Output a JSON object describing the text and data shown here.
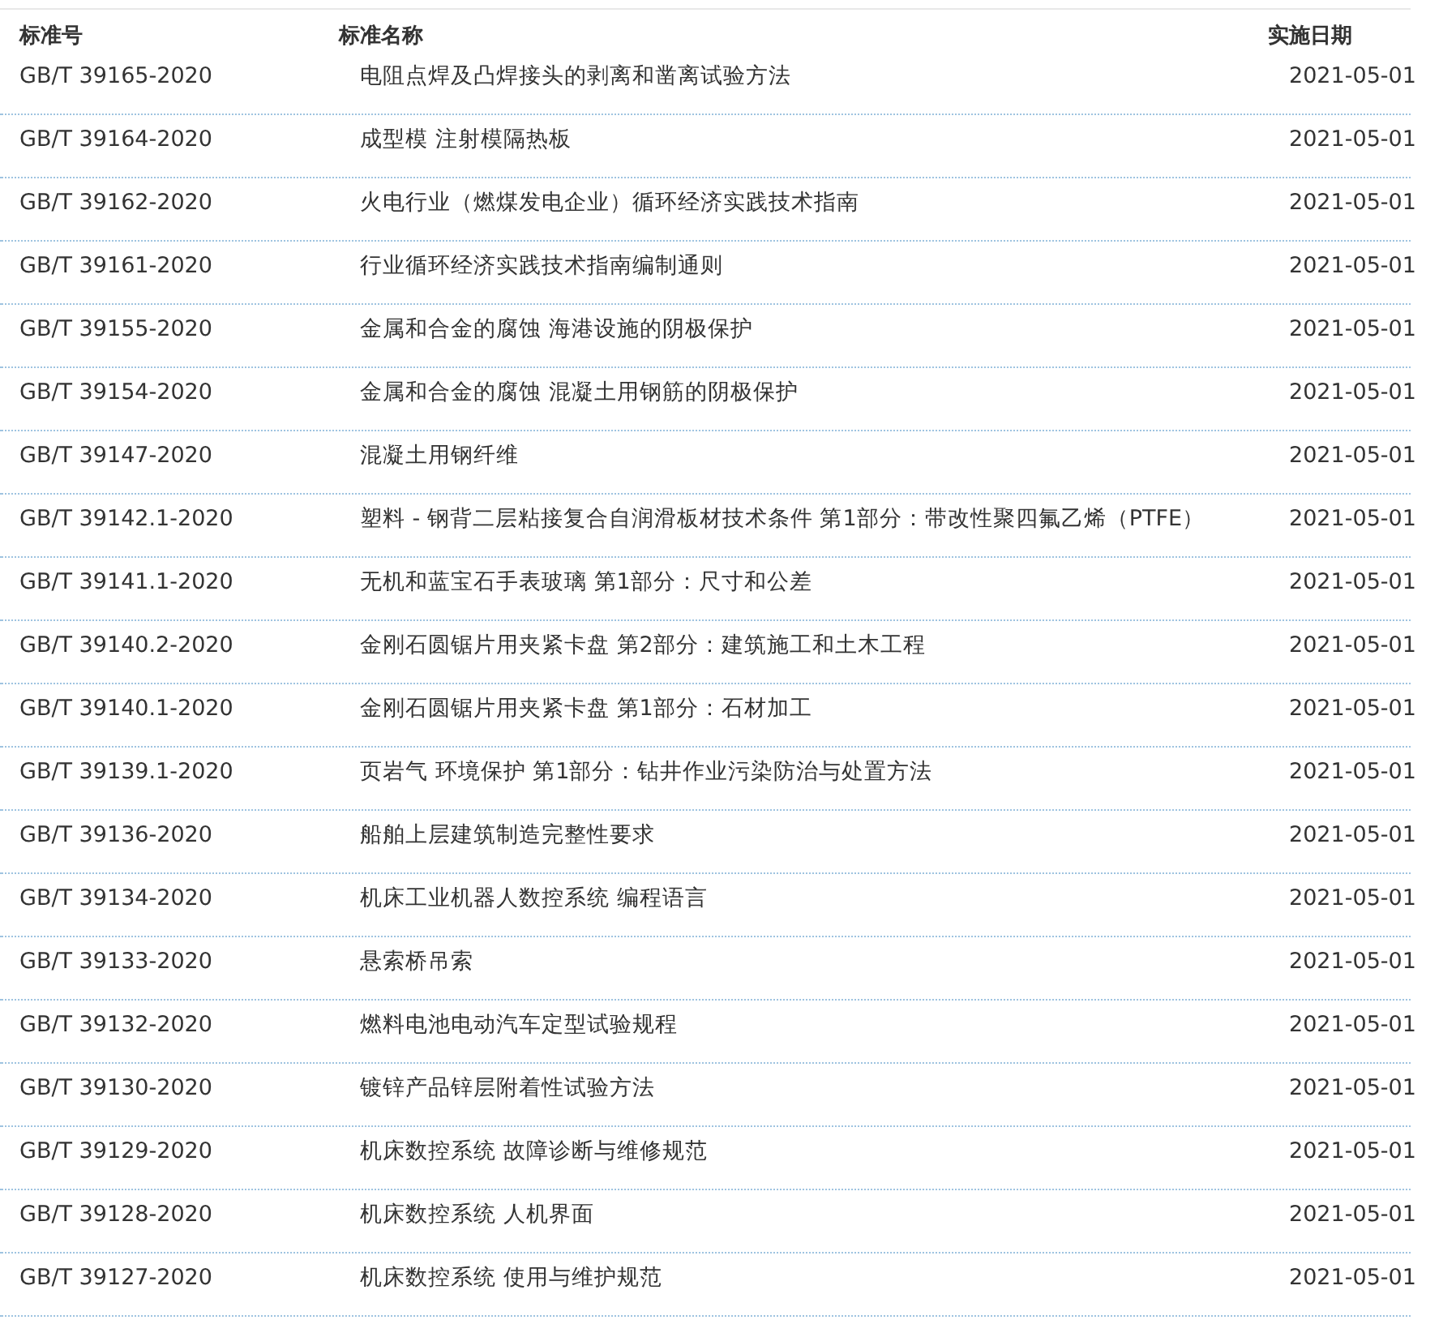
{
  "table": {
    "columns": [
      "标准号",
      "标准名称",
      "实施日期"
    ],
    "rows": [
      {
        "number": "GB/T 39165-2020",
        "name": "电阻点焊及凸焊接头的剥离和凿离试验方法",
        "date": "2021-05-01"
      },
      {
        "number": "GB/T 39164-2020",
        "name": "成型模 注射模隔热板",
        "date": "2021-05-01"
      },
      {
        "number": "GB/T 39162-2020",
        "name": "火电行业（燃煤发电企业）循环经济实践技术指南",
        "date": "2021-05-01"
      },
      {
        "number": "GB/T 39161-2020",
        "name": "行业循环经济实践技术指南编制通则",
        "date": "2021-05-01"
      },
      {
        "number": "GB/T 39155-2020",
        "name": "金属和合金的腐蚀 海港设施的阴极保护",
        "date": "2021-05-01"
      },
      {
        "number": "GB/T 39154-2020",
        "name": "金属和合金的腐蚀 混凝土用钢筋的阴极保护",
        "date": "2021-05-01"
      },
      {
        "number": "GB/T 39147-2020",
        "name": "混凝土用钢纤维",
        "date": "2021-05-01"
      },
      {
        "number": "GB/T 39142.1-2020",
        "name": "塑料 - 钢背二层粘接复合自润滑板材技术条件 第1部分：带改性聚四氟乙烯（PTFE）",
        "date": "2021-05-01"
      },
      {
        "number": "GB/T 39141.1-2020",
        "name": "无机和蓝宝石手表玻璃 第1部分：尺寸和公差",
        "date": "2021-05-01"
      },
      {
        "number": "GB/T 39140.2-2020",
        "name": "金刚石圆锯片用夹紧卡盘 第2部分：建筑施工和土木工程",
        "date": "2021-05-01"
      },
      {
        "number": "GB/T 39140.1-2020",
        "name": "金刚石圆锯片用夹紧卡盘 第1部分：石材加工",
        "date": "2021-05-01"
      },
      {
        "number": "GB/T 39139.1-2020",
        "name": "页岩气 环境保护 第1部分：钻井作业污染防治与处置方法",
        "date": "2021-05-01"
      },
      {
        "number": "GB/T 39136-2020",
        "name": "船舶上层建筑制造完整性要求",
        "date": "2021-05-01"
      },
      {
        "number": "GB/T 39134-2020",
        "name": "机床工业机器人数控系统 编程语言",
        "date": "2021-05-01"
      },
      {
        "number": "GB/T 39133-2020",
        "name": "悬索桥吊索",
        "date": "2021-05-01"
      },
      {
        "number": "GB/T 39132-2020",
        "name": "燃料电池电动汽车定型试验规程",
        "date": "2021-05-01"
      },
      {
        "number": "GB/T 39130-2020",
        "name": "镀锌产品锌层附着性试验方法",
        "date": "2021-05-01"
      },
      {
        "number": "GB/T 39129-2020",
        "name": "机床数控系统 故障诊断与维修规范",
        "date": "2021-05-01"
      },
      {
        "number": "GB/T 39128-2020",
        "name": "机床数控系统 人机界面",
        "date": "2021-05-01"
      },
      {
        "number": "GB/T 39127-2020",
        "name": "机床数控系统 使用与维护规范",
        "date": "2021-05-01"
      }
    ]
  }
}
